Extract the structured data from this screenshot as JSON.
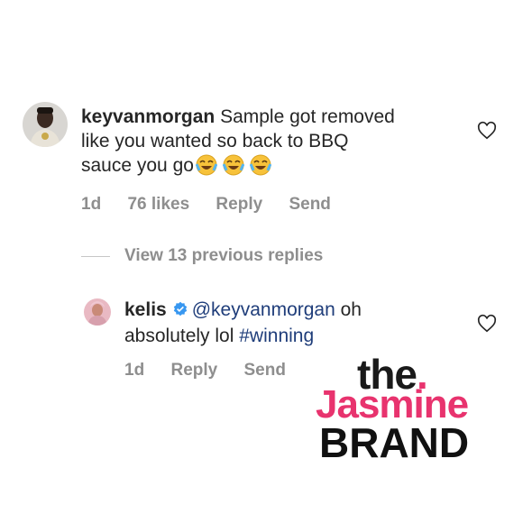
{
  "comments": [
    {
      "username": "keyvanmorgan",
      "text_line1": "Sample got removed",
      "text_line2": "like you wanted so back to BBQ",
      "text_line3": "sauce you go",
      "emoji": [
        "😂",
        "😂",
        "😂"
      ],
      "time": "1d",
      "likes": "76 likes",
      "reply_label": "Reply",
      "send_label": "Send",
      "icon": "heart-outline-icon"
    },
    {
      "username": "kelis",
      "verified": true,
      "mention": "@keyvanmorgan",
      "text_after_mention": "oh",
      "text_line2": "absolutely lol",
      "hashtag": "#winning",
      "time": "1d",
      "reply_label": "Reply",
      "send_label": "Send",
      "icon": "heart-outline-icon"
    }
  ],
  "view_replies_label": "View 13 previous replies",
  "watermark": {
    "the": "the",
    "jasmine": "Jasmine",
    "brand": "BRAND"
  },
  "colors": {
    "mention": "#1f3d7a",
    "meta": "#8e8e8e",
    "brand_pink": "#e8336e",
    "verified_blue": "#3897f0"
  }
}
